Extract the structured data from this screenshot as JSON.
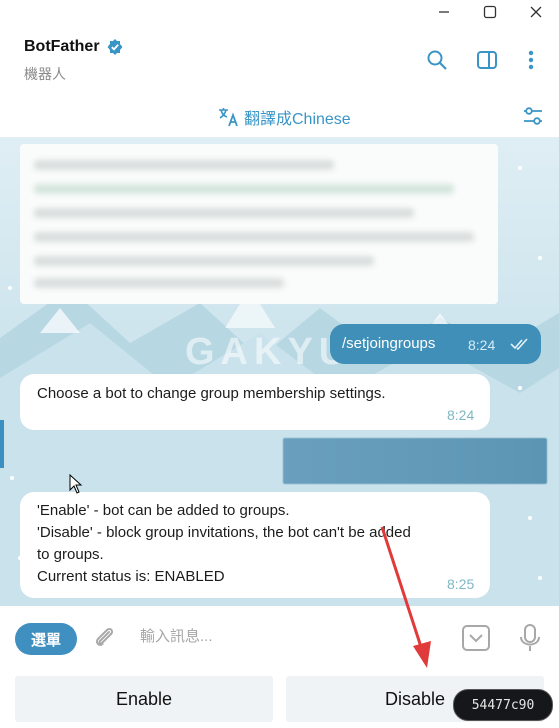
{
  "window": {
    "minimize_icon": "minimize-icon",
    "maximize_icon": "maximize-icon",
    "close_icon": "close-icon"
  },
  "header": {
    "title": "BotFather",
    "subtitle": "機器人",
    "verified_color": "#3a95c7"
  },
  "translate": {
    "label": "翻譯成Chinese"
  },
  "messages": [
    {
      "type": "outgoing",
      "text": "/setjoingroups",
      "time": "8:24"
    },
    {
      "type": "incoming",
      "text": "Choose a bot to change group membership settings.",
      "time": "8:24"
    },
    {
      "type": "incoming",
      "lines": [
        "'Enable' - bot can be added to groups.",
        "'Disable' - block group invitations, the bot can't be added",
        "to groups.",
        "Current status is: ENABLED"
      ],
      "time": "8:25"
    }
  ],
  "watermark": "GAKYUKR",
  "composer": {
    "menu_label": "選單",
    "placeholder": "輸入訊息..."
  },
  "keyboard": {
    "enable_label": "Enable",
    "disable_label": "Disable"
  },
  "badge": "54477c90",
  "colors": {
    "accent": "#3f8fc0",
    "annotation": "#e03a3a"
  }
}
